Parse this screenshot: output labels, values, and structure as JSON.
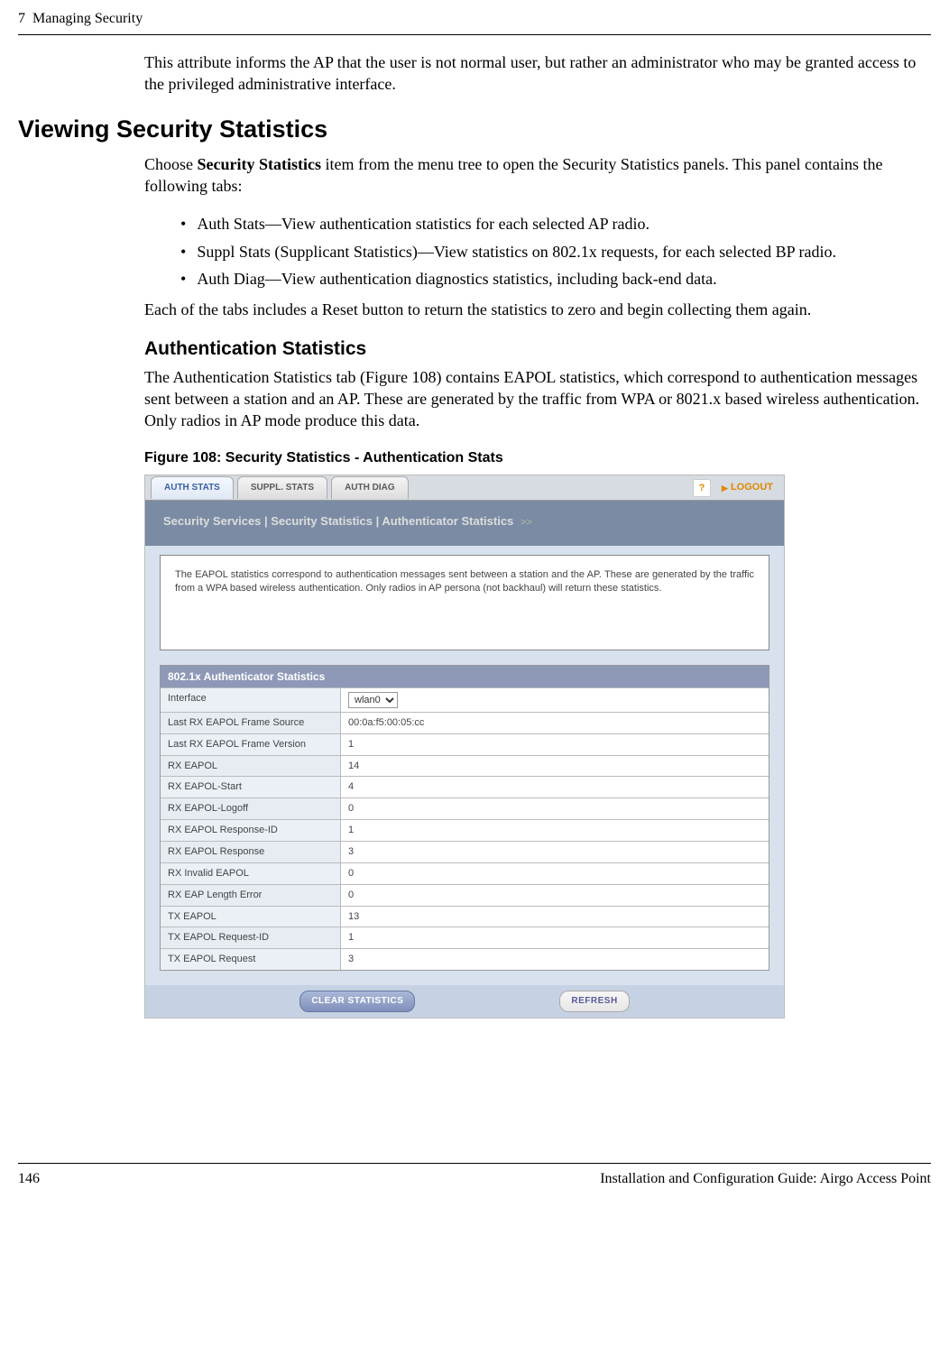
{
  "header": {
    "chapter": "7",
    "chapter_title": "Managing Security"
  },
  "intro_para": "This attribute informs the AP that the user is not normal user, but rather an administrator who may be granted access to the privileged administrative interface.",
  "section_title": "Viewing Security Statistics",
  "section_intro_a": "Choose ",
  "section_intro_bold": "Security Statistics",
  "section_intro_b": " item from the menu tree to open the Security Statistics panels. This panel contains the following tabs:",
  "tabs_desc": [
    "Auth Stats—View authentication statistics for each selected AP radio.",
    "Suppl Stats (Supplicant Statistics)—View statistics on 802.1x requests, for each selected BP radio.",
    "Auth Diag—View authentication diagnostics statistics, including back-end data."
  ],
  "reset_note": "Each of the tabs includes a Reset button to return the statistics to zero and begin collecting them again.",
  "subsection_title": "Authentication Statistics",
  "subsection_para": "The Authentication Statistics tab (Figure 108) contains EAPOL statistics, which correspond to authentication messages sent between a station and an AP. These are generated by the traffic from WPA or 8021.x based wireless authentication. Only radios in AP mode produce this data.",
  "figure_caption": "Figure 108:    Security Statistics - Authentication Stats",
  "screenshot": {
    "tabs": {
      "auth_stats": "AUTH STATS",
      "suppl_stats": "SUPPL. STATS",
      "auth_diag": "AUTH DIAG"
    },
    "help": "?",
    "logout": "LOGOUT",
    "breadcrumb": "Security Services | Security Statistics | Authenticator Statistics",
    "breadcrumb_suffix": ">>",
    "desc": "The EAPOL statistics correspond to authentication messages sent between a station and the AP. These are generated by the traffic from a WPA based wireless authentication. Only radios in AP persona (not backhaul) will return these statistics.",
    "panel_title": "802.1x Authenticator Statistics",
    "interface_label": "Interface",
    "interface_value": "wlan0",
    "rows": [
      {
        "label": "Last RX EAPOL Frame Source",
        "value": "00:0a:f5:00:05:cc"
      },
      {
        "label": "Last RX EAPOL Frame Version",
        "value": "1"
      },
      {
        "label": "RX EAPOL",
        "value": "14"
      },
      {
        "label": "RX EAPOL-Start",
        "value": "4"
      },
      {
        "label": "RX EAPOL-Logoff",
        "value": "0"
      },
      {
        "label": "RX EAPOL Response-ID",
        "value": "1"
      },
      {
        "label": "RX EAPOL Response",
        "value": "3"
      },
      {
        "label": "RX Invalid EAPOL",
        "value": "0"
      },
      {
        "label": "RX EAP Length Error",
        "value": "0"
      },
      {
        "label": "TX EAPOL",
        "value": "13"
      },
      {
        "label": "TX EAPOL Request-ID",
        "value": "1"
      },
      {
        "label": "TX EAPOL Request",
        "value": "3"
      }
    ],
    "clear_btn": "CLEAR STATISTICS",
    "refresh_btn": "REFRESH"
  },
  "footer": {
    "page": "146",
    "guide": "Installation and Configuration Guide: Airgo Access Point"
  }
}
